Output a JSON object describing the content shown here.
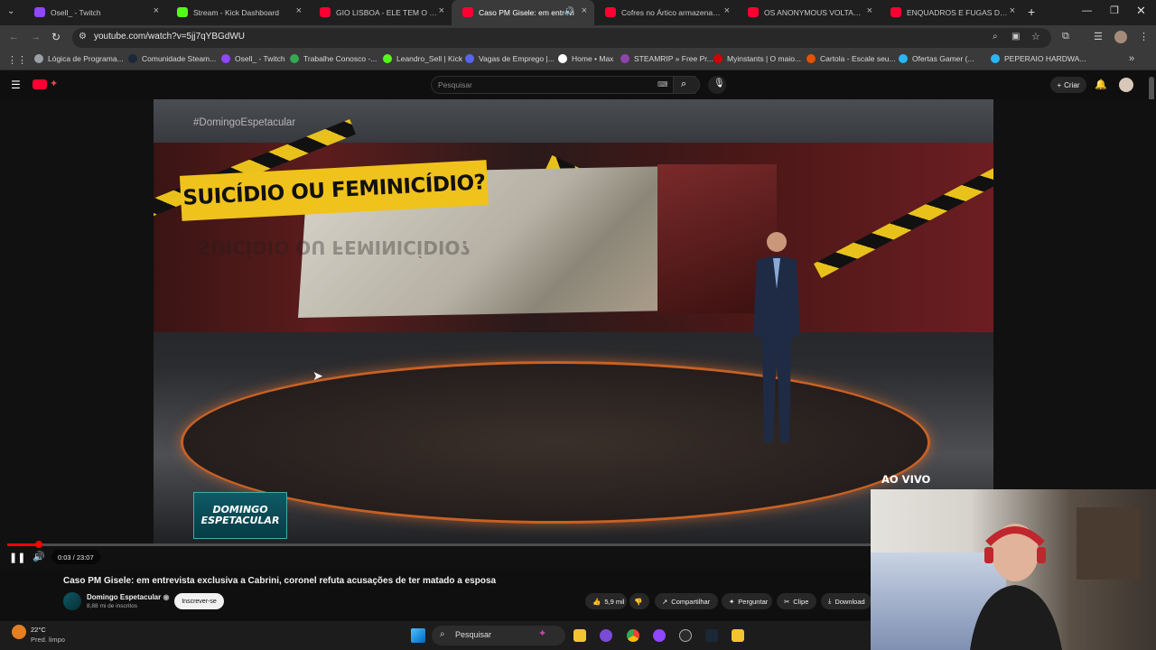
{
  "browser": {
    "tabs": [
      {
        "label": "Osell_ - Twitch",
        "color": "#9146ff",
        "active": false
      },
      {
        "label": "Stream - Kick Dashboard",
        "color": "#53fc18",
        "active": false
      },
      {
        "label": "GIO LISBOA - ELE TEM O SONH",
        "color": "#ff0033",
        "active": false
      },
      {
        "label": "Caso PM Gisele: em entrevi",
        "color": "#ff0033",
        "active": true
      },
      {
        "label": "Cofres no Ártico armazenam se",
        "color": "#ff0033",
        "active": false
      },
      {
        "label": "OS ANONYMOUS VOLTARAM! |",
        "color": "#ff0033",
        "active": false
      },
      {
        "label": "ENQUADROS E FUGAS DE MOTO",
        "color": "#ff0033",
        "active": false
      }
    ],
    "new_tab_glyph": "+",
    "close_glyph": "×",
    "url": "youtube.com/watch?v=5jj7qYBGdWU",
    "bookmarks": [
      {
        "label": "Lógica de Programa...",
        "color": "#9aa0a6"
      },
      {
        "label": "Comunidade Steam...",
        "color": "#1b2838"
      },
      {
        "label": "Osell_ - Twitch",
        "color": "#9146ff"
      },
      {
        "label": "Trabalhe Conosco -...",
        "color": "#34a853"
      },
      {
        "label": "Leandro_Sell | Kick",
        "color": "#53fc18"
      },
      {
        "label": "Vagas de Emprego |...",
        "color": "#5865f2"
      },
      {
        "label": "Home • Max",
        "color": "#ffffff"
      },
      {
        "label": "STEAMRIP » Free Pr...",
        "color": "#8e44ad"
      },
      {
        "label": "Myinstants | O maio...",
        "color": "#d50000"
      },
      {
        "label": "Cartola - Escale seu...",
        "color": "#e65100"
      },
      {
        "label": "Ofertas Gamer (...",
        "color": "#29b6f6"
      },
      {
        "label": "PEPERAIO HARDWA...",
        "color": "#29b6f6"
      }
    ]
  },
  "youtube": {
    "search_placeholder": "Pesquisar",
    "create_label": "Criar",
    "video": {
      "hashtag": "#DomingoEspetacular",
      "headline": "SUICÍDIO OU FEMINICÍDIO?",
      "reflection": "SUICÍDIO OU FEMINICÍDIO?",
      "logo_line1": "DOMINGO",
      "logo_line2": "ESPETACULAR",
      "live_label": "AO VIVO",
      "time": "0:03 / 23:07",
      "progress": 0.028
    },
    "title": "Caso PM Gisele: em entrevista exclusiva a Cabrini, coronel refuta acusações de ter matado a esposa",
    "channel": {
      "name": "Domingo Espetacular",
      "subs": "8,88 mi de inscritos",
      "subscribe_label": "Inscrever-se"
    },
    "actions": {
      "likes": "5,9 mil",
      "share": "Compartilhar",
      "ask": "Perguntar",
      "clip": "Clipe",
      "download": "Download"
    }
  },
  "taskbar": {
    "weather_temp": "22°C",
    "weather_desc": "Pred. limpo",
    "search_placeholder": "Pesquisar"
  }
}
